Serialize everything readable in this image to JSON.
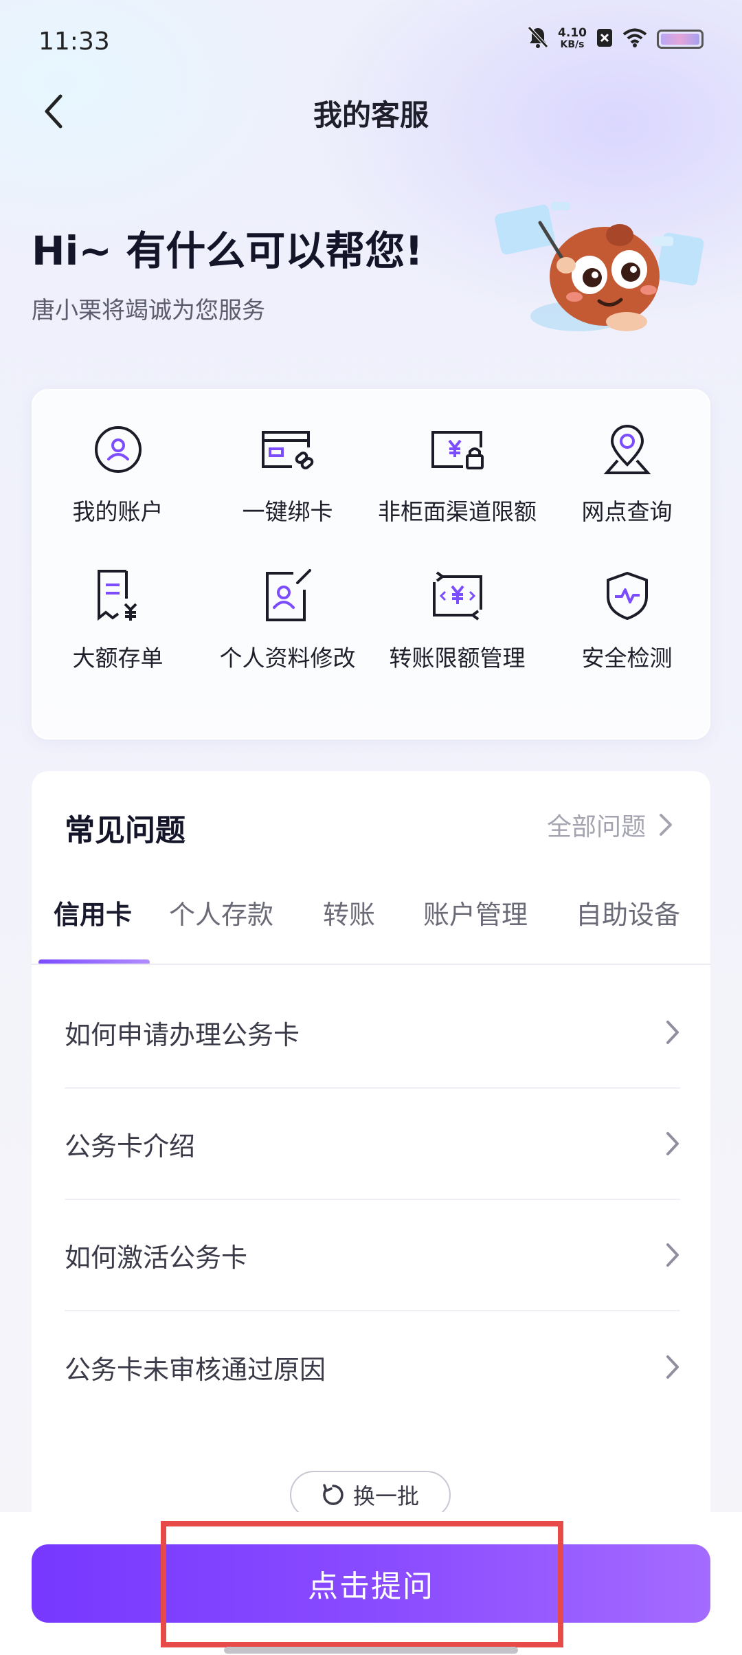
{
  "status_bar": {
    "time": "11:33",
    "net_speed_value": "4.10",
    "net_speed_unit": "KB/s"
  },
  "nav": {
    "title": "我的客服"
  },
  "hero": {
    "title": "Hi~ 有什么可以帮您!",
    "subtitle": "唐小栗将竭诚为您服务"
  },
  "services": [
    {
      "label": "我的账户",
      "icon": "user-circle-icon"
    },
    {
      "label": "一键绑卡",
      "icon": "card-link-icon"
    },
    {
      "label": "非柜面渠道限额",
      "icon": "yuan-lock-icon"
    },
    {
      "label": "网点查询",
      "icon": "location-pin-icon"
    },
    {
      "label": "大额存单",
      "icon": "receipt-yuan-icon"
    },
    {
      "label": "个人资料修改",
      "icon": "profile-edit-icon"
    },
    {
      "label": "转账限额管理",
      "icon": "transfer-yuan-icon"
    },
    {
      "label": "安全检测",
      "icon": "shield-check-icon"
    }
  ],
  "faq": {
    "title": "常见问题",
    "all_label": "全部问题",
    "tabs": [
      {
        "label": "信用卡",
        "active": true
      },
      {
        "label": "个人存款",
        "active": false
      },
      {
        "label": "转账",
        "active": false
      },
      {
        "label": "账户管理",
        "active": false
      },
      {
        "label": "自助设备",
        "active": false
      }
    ],
    "items": [
      "如何申请办理公务卡",
      "公务卡介绍",
      "如何激活公务卡",
      "公务卡未审核通过原因"
    ],
    "refresh_label": "换一批"
  },
  "bottom": {
    "ask_label": "点击提问"
  },
  "colors": {
    "accent": "#7b4dff",
    "highlight": "#e84a4a"
  }
}
